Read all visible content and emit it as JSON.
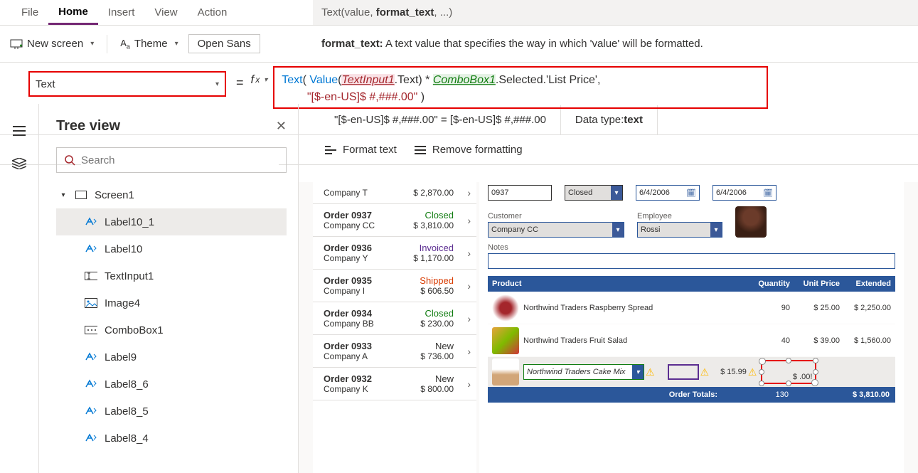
{
  "menu": {
    "file": "File",
    "home": "Home",
    "insert": "Insert",
    "view": "View",
    "action": "Action"
  },
  "ribbon": {
    "new_screen": "New screen",
    "theme": "Theme",
    "font": "Open Sans"
  },
  "signature": {
    "fn": "Text",
    "sig_rest": "(value, ",
    "sig_bold": "format_text",
    "sig_tail": ", ...)",
    "desc_label": "format_text:",
    "desc": " A text value that specifies the way in which 'value' will be formatted."
  },
  "property_selector": "Text",
  "formula": {
    "line1_pre": "Text( Value(",
    "ref1": "TextInput1",
    "line1_post1": ".Text) * ",
    "ref2": "ComboBox1",
    "line1_post2": ".Selected.'List Price',",
    "line2_indent": "        ",
    "str": "\"[$-en-US]$ #,###.00\"",
    "line2_post": " )"
  },
  "status": {
    "preview": "\"[$-en-US]$ #,###.00\"  =  [$-en-US]$ #,###.00",
    "dt_label": "Data type: ",
    "dt": "text"
  },
  "fmtbar": {
    "format": "Format text",
    "remove": "Remove formatting"
  },
  "tree": {
    "title": "Tree view",
    "search_placeholder": "Search",
    "root": "Screen1",
    "items": [
      "Label10_1",
      "Label10",
      "TextInput1",
      "Image4",
      "ComboBox1",
      "Label9",
      "Label8_6",
      "Label8_5",
      "Label8_4"
    ]
  },
  "orders": [
    {
      "title": "",
      "company": "Company T",
      "amount": "$ 2,870.00",
      "status": "",
      "cls": ""
    },
    {
      "title": "Order 0937",
      "company": "Company CC",
      "amount": "$ 3,810.00",
      "status": "Closed",
      "cls": "st-closed"
    },
    {
      "title": "Order 0936",
      "company": "Company Y",
      "amount": "$ 1,170.00",
      "status": "Invoiced",
      "cls": "st-invoiced"
    },
    {
      "title": "Order 0935",
      "company": "Company I",
      "amount": "$ 606.50",
      "status": "Shipped",
      "cls": "st-shipped"
    },
    {
      "title": "Order 0934",
      "company": "Company BB",
      "amount": "$ 230.00",
      "status": "Closed",
      "cls": "st-closed"
    },
    {
      "title": "Order 0933",
      "company": "Company A",
      "amount": "$ 736.00",
      "status": "New",
      "cls": "st-new"
    },
    {
      "title": "Order 0932",
      "company": "Company K",
      "amount": "$ 800.00",
      "status": "New",
      "cls": "st-new"
    }
  ],
  "detail": {
    "order_no": "0937",
    "status_label": "Closed",
    "status_val": "Closed",
    "date1": "6/4/2006",
    "date2": "6/4/2006",
    "cust_label": "Customer",
    "cust": "Company CC",
    "emp_label": "Employee",
    "emp": "Rossi",
    "notes_label": "Notes",
    "head": {
      "product": "Product",
      "qty": "Quantity",
      "unit": "Unit Price",
      "ext": "Extended"
    },
    "lines": [
      {
        "name": "Northwind Traders Raspberry Spread",
        "qty": "90",
        "unit": "$ 25.00",
        "ext": "$ 2,250.00",
        "img": "a"
      },
      {
        "name": "Northwind Traders Fruit Salad",
        "qty": "40",
        "unit": "$ 39.00",
        "ext": "$ 1,560.00",
        "img": "b"
      }
    ],
    "new_line": {
      "combo": "Northwind Traders Cake Mix",
      "unit": "$ 15.99",
      "ext": "$ .00!"
    },
    "totals": {
      "label": "Order Totals:",
      "qty": "130",
      "amount": "$ 3,810.00"
    }
  }
}
